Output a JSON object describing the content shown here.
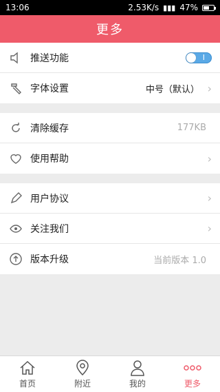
{
  "status": {
    "time": "13:06",
    "speed": "2.53K/s",
    "battery": "47%",
    "battery_level": 0.47
  },
  "header": {
    "title": "更多"
  },
  "groups": [
    [
      {
        "label": "推送功能",
        "icon": "speaker-icon",
        "toggle_on": true
      },
      {
        "label": "字体设置",
        "icon": "hammer-icon",
        "value": "中号（默认）"
      }
    ],
    [
      {
        "label": "清除缓存",
        "icon": "refresh-icon",
        "value": "177KB"
      },
      {
        "label": "使用帮助",
        "icon": "heart-icon"
      }
    ],
    [
      {
        "label": "用户协议",
        "icon": "pencil-icon"
      },
      {
        "label": "关注我们",
        "icon": "eye-icon"
      },
      {
        "label": "版本升级",
        "icon": "upload-icon",
        "value": "当前版本 1.0"
      }
    ]
  ],
  "tabs": [
    {
      "label": "首页",
      "icon": "home-icon"
    },
    {
      "label": "附近",
      "icon": "location-icon"
    },
    {
      "label": "我的",
      "icon": "user-icon"
    },
    {
      "label": "更多",
      "icon": "more-icon",
      "active": true
    }
  ],
  "colors": {
    "accent": "#ef5b6a",
    "toggle": "#5aa9e6"
  }
}
